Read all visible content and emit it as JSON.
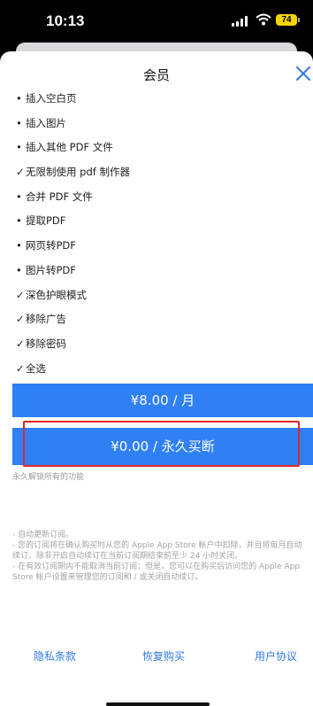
{
  "status": {
    "time": "10:13",
    "battery": "74"
  },
  "header": {
    "title": "会员"
  },
  "features": [
    {
      "mark": "•",
      "text": "插入空白页"
    },
    {
      "mark": "•",
      "text": "插入图片"
    },
    {
      "mark": "•",
      "text": "插入其他 PDF 文件"
    },
    {
      "mark": "✓",
      "text": "无限制使用 pdf 制作器"
    },
    {
      "mark": "•",
      "text": "合并 PDF 文件"
    },
    {
      "mark": "•",
      "text": "提取PDF"
    },
    {
      "mark": "•",
      "text": "网页转PDF"
    },
    {
      "mark": "•",
      "text": "图片转PDF"
    },
    {
      "mark": "✓",
      "text": "深色护眼模式"
    },
    {
      "mark": "✓",
      "text": "移除广告"
    },
    {
      "mark": "✓",
      "text": "移除密码"
    },
    {
      "mark": "✓",
      "text": "全选"
    }
  ],
  "plans": {
    "monthly_label": "¥8.00 / 月",
    "lifetime_label": "¥0.00 / 永久买断"
  },
  "unlock_note": "永久解锁所有的功能",
  "notes": [
    "- 自动更新订阅。",
    "- 您的订阅将在确认购买时从您的 Apple App Store 帐户中扣除，并且将每月自动续订，除非开启自动续订在当前订阅期结束前至少 24 小时关闭。",
    "- 在有效订阅期内不能取消当前订阅；但是，您可以在购买后访问您的 Apple App Store 帐户设置来管理您的订阅和 / 或关闭自动续订。"
  ],
  "footer": {
    "privacy": "隐私条款",
    "restore": "恢复购买",
    "agreement": "用户协议"
  },
  "colors": {
    "accent": "#2f80f4",
    "highlight": "#e0262b",
    "link": "#2f7ae5"
  }
}
